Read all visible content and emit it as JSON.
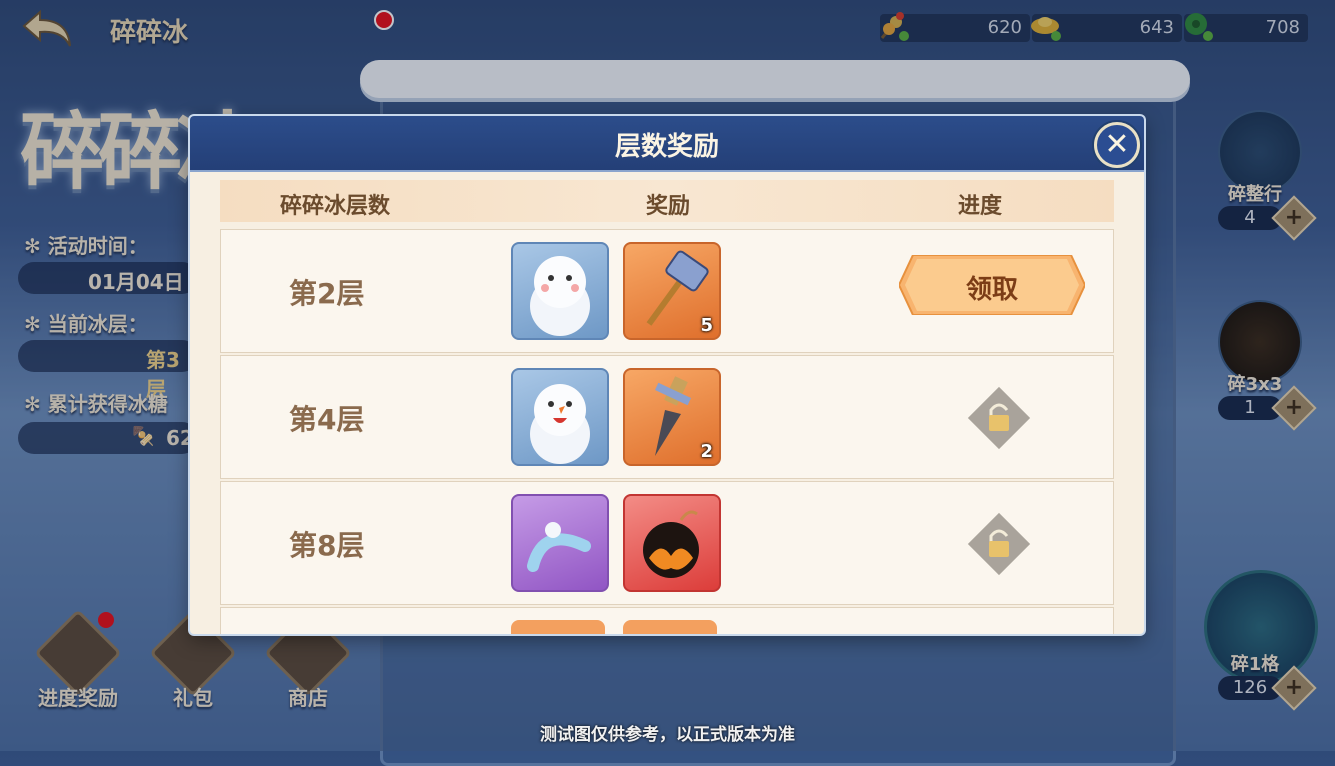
{
  "header": {
    "title": "碎碎冰",
    "currencies": [
      {
        "icon": "candy-skewer-icon",
        "value": "620"
      },
      {
        "icon": "gold-ingot-icon",
        "value": "643"
      },
      {
        "icon": "jade-icon",
        "value": "708"
      }
    ]
  },
  "left_panel": {
    "logo_text": "碎碎冰",
    "activity_time_label": "✻ 活动时间：",
    "activity_time_value": "01月04日",
    "current_floor_label": "✻ 当前冰层：",
    "current_floor_value": "第3层",
    "candy_label": "✻ 累计获得冰糖",
    "candy_value": "62"
  },
  "bottom_buttons": [
    {
      "label": "进度奖励",
      "has_dot": true
    },
    {
      "label": "礼包",
      "has_dot": true
    },
    {
      "label": "商店",
      "has_dot": true
    }
  ],
  "tools": [
    {
      "name": "碎整行",
      "count": "4",
      "icon": "chisel-icon"
    },
    {
      "name": "碎3x3",
      "count": "1",
      "icon": "bomb-icon"
    },
    {
      "name": "碎1格",
      "count": "126",
      "icon": "hammer-icon"
    }
  ],
  "modal": {
    "title": "层数奖励",
    "col_floor": "碎碎冰层数",
    "col_reward": "奖励",
    "col_progress": "进度",
    "rows": [
      {
        "floor": "第2层",
        "rewards": [
          {
            "icon": "snowman-icon",
            "qty": ""
          },
          {
            "icon": "hammer-icon",
            "qty": "5"
          }
        ],
        "state": "claim",
        "claim_label": "领取"
      },
      {
        "floor": "第4层",
        "rewards": [
          {
            "icon": "snowman-smile-icon",
            "qty": ""
          },
          {
            "icon": "chisel-icon",
            "qty": "2"
          }
        ],
        "state": "locked"
      },
      {
        "floor": "第8层",
        "rewards": [
          {
            "icon": "headband-icon",
            "qty": ""
          },
          {
            "icon": "bomb-icon",
            "qty": ""
          }
        ],
        "state": "locked"
      }
    ]
  },
  "footer_note": "测试图仅供参考，以正式版本为准"
}
